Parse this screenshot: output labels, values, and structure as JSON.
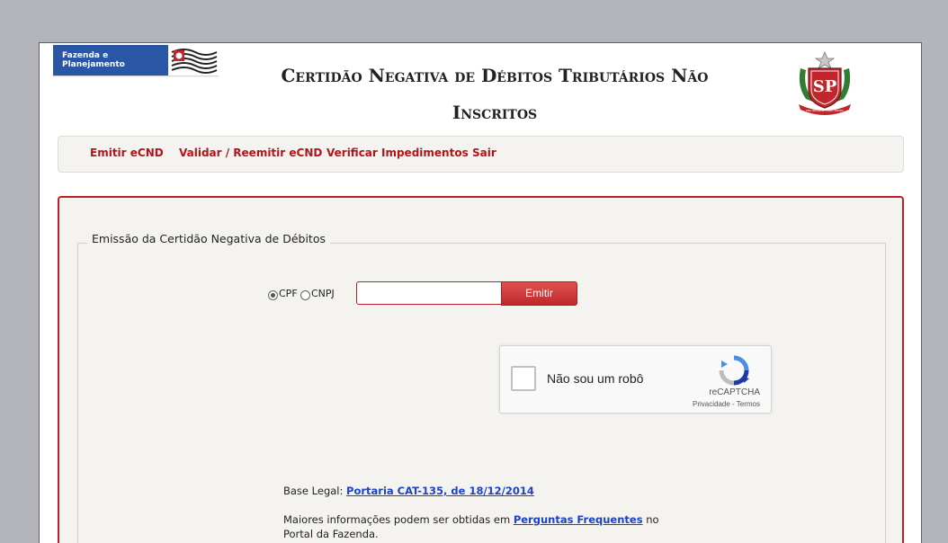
{
  "header": {
    "logo_text_line1": "Fazenda e",
    "logo_text_line2": "Planejamento",
    "title_line1": "Certidão Negativa de Débitos Tributários Não",
    "title_line2": "Inscritos",
    "crest_text": "SP",
    "crest_motto": "PRO BRASILIA FIANT EXIMIA"
  },
  "nav": {
    "items": [
      {
        "label": "Emitir eCND"
      },
      {
        "label": "Validar / Reemitir eCND"
      },
      {
        "label": "Verificar Impedimentos"
      },
      {
        "label": "Sair"
      }
    ]
  },
  "form": {
    "legend": "Emissão da Certidão Negativa de Débitos",
    "radio_cpf_label": "CPF",
    "radio_cnpj_label": "CNPJ",
    "selected_doc_type": "CPF",
    "document_value": "",
    "emit_label": "Emitir"
  },
  "recaptcha": {
    "label": "Não sou um robô",
    "brand": "reCAPTCHA",
    "privacy": "Privacidade",
    "separator": " - ",
    "terms": "Termos"
  },
  "info": {
    "base_legal_prefix": "Base Legal: ",
    "base_legal_link": "Portaria CAT-135, de 18/12/2014",
    "more_info_prefix": "Maiores informações podem ser obtidas em ",
    "more_info_link": "Perguntas Frequentes",
    "more_info_suffix": " no Portal da Fazenda."
  },
  "colors": {
    "accent_red": "#b72228",
    "nav_text": "#b3141a",
    "link_blue": "#1b43c4",
    "logo_blue": "#2a56a6"
  }
}
